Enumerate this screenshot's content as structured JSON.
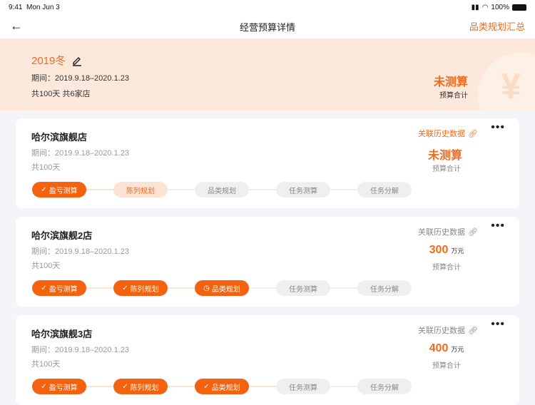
{
  "status_bar": {
    "time": "9:41",
    "date": "Mon Jun 3",
    "battery": "100%"
  },
  "nav": {
    "title": "经营预算详情",
    "right_link": "品类规划汇总"
  },
  "summary": {
    "name": "2019冬",
    "period": "期间：2019.9.18–2020.1.23",
    "days": "共100天 共6家店",
    "budget_value": "未测算",
    "budget_label": "预算合计",
    "bg_symbol": "¥"
  },
  "colors": {
    "accent": "#f26a1b",
    "hero_bg": "#fde9dc"
  },
  "stores": [
    {
      "name": "哈尔滨旗舰店",
      "period": "期间：2019.9.18–2020.1.23",
      "days": "共100天",
      "history_link": "关联历史数据",
      "history_active": true,
      "budget_value": "未测算",
      "budget_unit": "",
      "budget_label": "预算合计",
      "steps": [
        {
          "label": "盈亏测算",
          "state": "done"
        },
        {
          "label": "陈列规划",
          "state": "current"
        },
        {
          "label": "品类规划",
          "state": "pending"
        },
        {
          "label": "任务测算",
          "state": "pending"
        },
        {
          "label": "任务分解",
          "state": "pending"
        }
      ]
    },
    {
      "name": "哈尔滨旗舰2店",
      "period": "期间：2019.9.18–2020.1.23",
      "days": "共100天",
      "history_link": "关联历史数据",
      "history_active": false,
      "budget_value": "300",
      "budget_unit": "万元",
      "budget_label": "预算合计",
      "steps": [
        {
          "label": "盈亏测算",
          "state": "done"
        },
        {
          "label": "陈列规划",
          "state": "done"
        },
        {
          "label": "品类规划",
          "state": "active"
        },
        {
          "label": "任务测算",
          "state": "pending"
        },
        {
          "label": "任务分解",
          "state": "pending"
        }
      ]
    },
    {
      "name": "哈尔滨旗舰3店",
      "period": "期间：2019.9.18–2020.1.23",
      "days": "共100天",
      "history_link": "关联历史数据",
      "history_active": false,
      "budget_value": "400",
      "budget_unit": "万元",
      "budget_label": "预算合计",
      "steps": [
        {
          "label": "盈亏测算",
          "state": "done"
        },
        {
          "label": "陈列规划",
          "state": "done"
        },
        {
          "label": "品类规划",
          "state": "done"
        },
        {
          "label": "任务测算",
          "state": "pending"
        },
        {
          "label": "任务分解",
          "state": "pending"
        }
      ]
    }
  ]
}
